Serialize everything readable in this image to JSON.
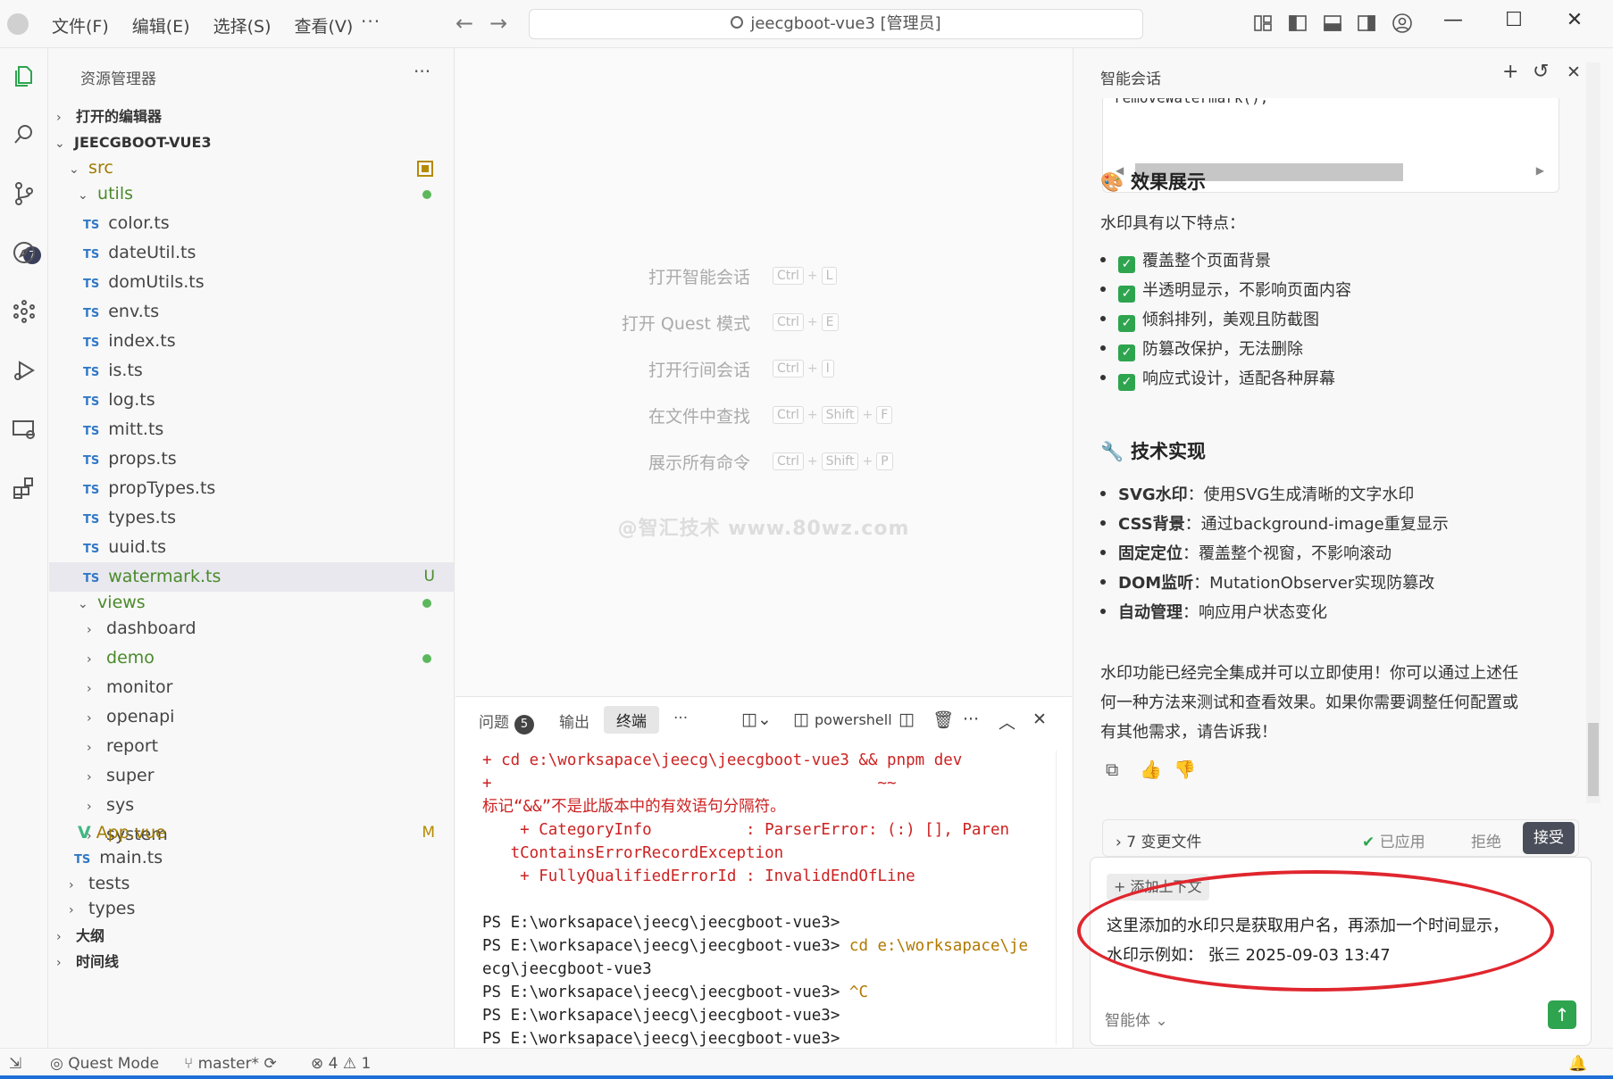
{
  "menu": [
    "文件(F)",
    "编辑(E)",
    "选择(S)",
    "查看(V)"
  ],
  "menu_more": "···",
  "command_center": "jeecgboot-vue3 [管理员]",
  "sidebar": {
    "title": "资源管理器",
    "more": "···",
    "open_editors": "打开的编辑器",
    "project": "JEECGBOOT-VUE3",
    "src": "src",
    "utils": "utils",
    "files": [
      "color.ts",
      "dateUtil.ts",
      "domUtils.ts",
      "env.ts",
      "index.ts",
      "is.ts",
      "log.ts",
      "mitt.ts",
      "props.ts",
      "propTypes.ts",
      "types.ts",
      "uuid.ts"
    ],
    "watermark": "watermark.ts",
    "watermark_status": "U",
    "views": "views",
    "view_folders": [
      "dashboard",
      "demo",
      "monitor",
      "openapi",
      "report",
      "super",
      "sys",
      "system"
    ],
    "app_vue": "App.vue",
    "app_status": "M",
    "main_ts": "main.ts",
    "tests": "tests",
    "types": "types",
    "outline": "大纲",
    "timeline": "时间线",
    "ts_label": "TS"
  },
  "activity": {
    "scm_badge": "7"
  },
  "editor": {
    "shortcuts": [
      {
        "label": "打开智能会话",
        "keys": [
          "Ctrl",
          "L"
        ]
      },
      {
        "label": "打开 Quest 模式",
        "keys": [
          "Ctrl",
          "E"
        ]
      },
      {
        "label": "打开行间会话",
        "keys": [
          "Ctrl",
          "I"
        ]
      },
      {
        "label": "在文件中查找",
        "keys": [
          "Ctrl",
          "Shift",
          "F"
        ]
      },
      {
        "label": "展示所有命令",
        "keys": [
          "Ctrl",
          "Shift",
          "P"
        ]
      }
    ],
    "watermark": "@智汇技术  www.80wz.com"
  },
  "panel": {
    "tabs": {
      "problems": "问题",
      "problems_count": "5",
      "output": "输出",
      "terminal": "终端"
    },
    "more": "···",
    "shell": "powershell",
    "terminal_lines": [
      {
        "c": "red",
        "t": "+ cd e:\\worksapace\\jeecg\\jeecgboot-vue3 && pnpm dev"
      },
      {
        "c": "red",
        "t": "+                                         ~~"
      },
      {
        "c": "red",
        "t": "标记“&&”不是此版本中的有效语句分隔符。"
      },
      {
        "c": "red",
        "t": "    + CategoryInfo          : ParserError: (:) [], Paren"
      },
      {
        "c": "red",
        "t": "   tContainsErrorRecordException"
      },
      {
        "c": "red",
        "t": "    + FullyQualifiedErrorId : InvalidEndOfLine"
      },
      {
        "c": "dark",
        "t": " "
      },
      {
        "c": "dark",
        "t": "PS E:\\worksapace\\jeecg\\jeecgboot-vue3>"
      },
      {
        "c": "dark",
        "t": "PS E:\\worksapace\\jeecg\\jeecgboot-vue3> cd e:\\worksapace\\je"
      },
      {
        "c": "dark",
        "t": "ecg\\jeecgboot-vue3"
      },
      {
        "c": "dark",
        "t": "PS E:\\worksapace\\jeecg\\jeecgboot-vue3> ^C"
      },
      {
        "c": "dark",
        "t": "PS E:\\worksapace\\jeecg\\jeecgboot-vue3>"
      },
      {
        "c": "dark",
        "t": "PS E:\\worksapace\\jeecg\\jeecgboot-vue3>"
      }
    ]
  },
  "chat": {
    "title": "智能会话",
    "code_line": "removeWatermark();",
    "h_effect": "效果展示",
    "effect_intro": "水印具有以下特点：",
    "features": [
      "覆盖整个页面背景",
      "半透明显示，不影响页面内容",
      "倾斜排列，美观且防截图",
      "防篡改保护，无法删除",
      "响应式设计，适配各种屏幕"
    ],
    "h_tech": "技术实现",
    "tech": [
      {
        "k": "SVG水印",
        "v": "：使用SVG生成清晰的文字水印"
      },
      {
        "k": "CSS背景",
        "v": "：通过background-image重复显示"
      },
      {
        "k": "固定定位",
        "v": "：覆盖整个视窗，不影响滚动"
      },
      {
        "k": "DOM监听",
        "v": "：MutationObserver实现防篡改"
      },
      {
        "k": "自动管理",
        "v": "：响应用户状态变化"
      }
    ],
    "summary": [
      "水印功能已经完全集成并可以立即使用！你可以通过上述任",
      "何一种方法来测试和查看效果。如果你需要调整任何配置或",
      "有其他需求，请告诉我！"
    ],
    "changes_label": "7 变更文件",
    "applied": "已应用",
    "reject": "拒绝",
    "accept": "接受",
    "add_context": "添加上下文",
    "prompt_lines": [
      "这里添加的水印只是获取用户名，再添加一个时间显示，",
      "水印示例如：  张三  2025-09-03 13:47"
    ],
    "agent": "智能体"
  },
  "status": {
    "quest_mode": "Quest Mode",
    "branch": "master*",
    "errors": "4",
    "warnings": "1"
  }
}
